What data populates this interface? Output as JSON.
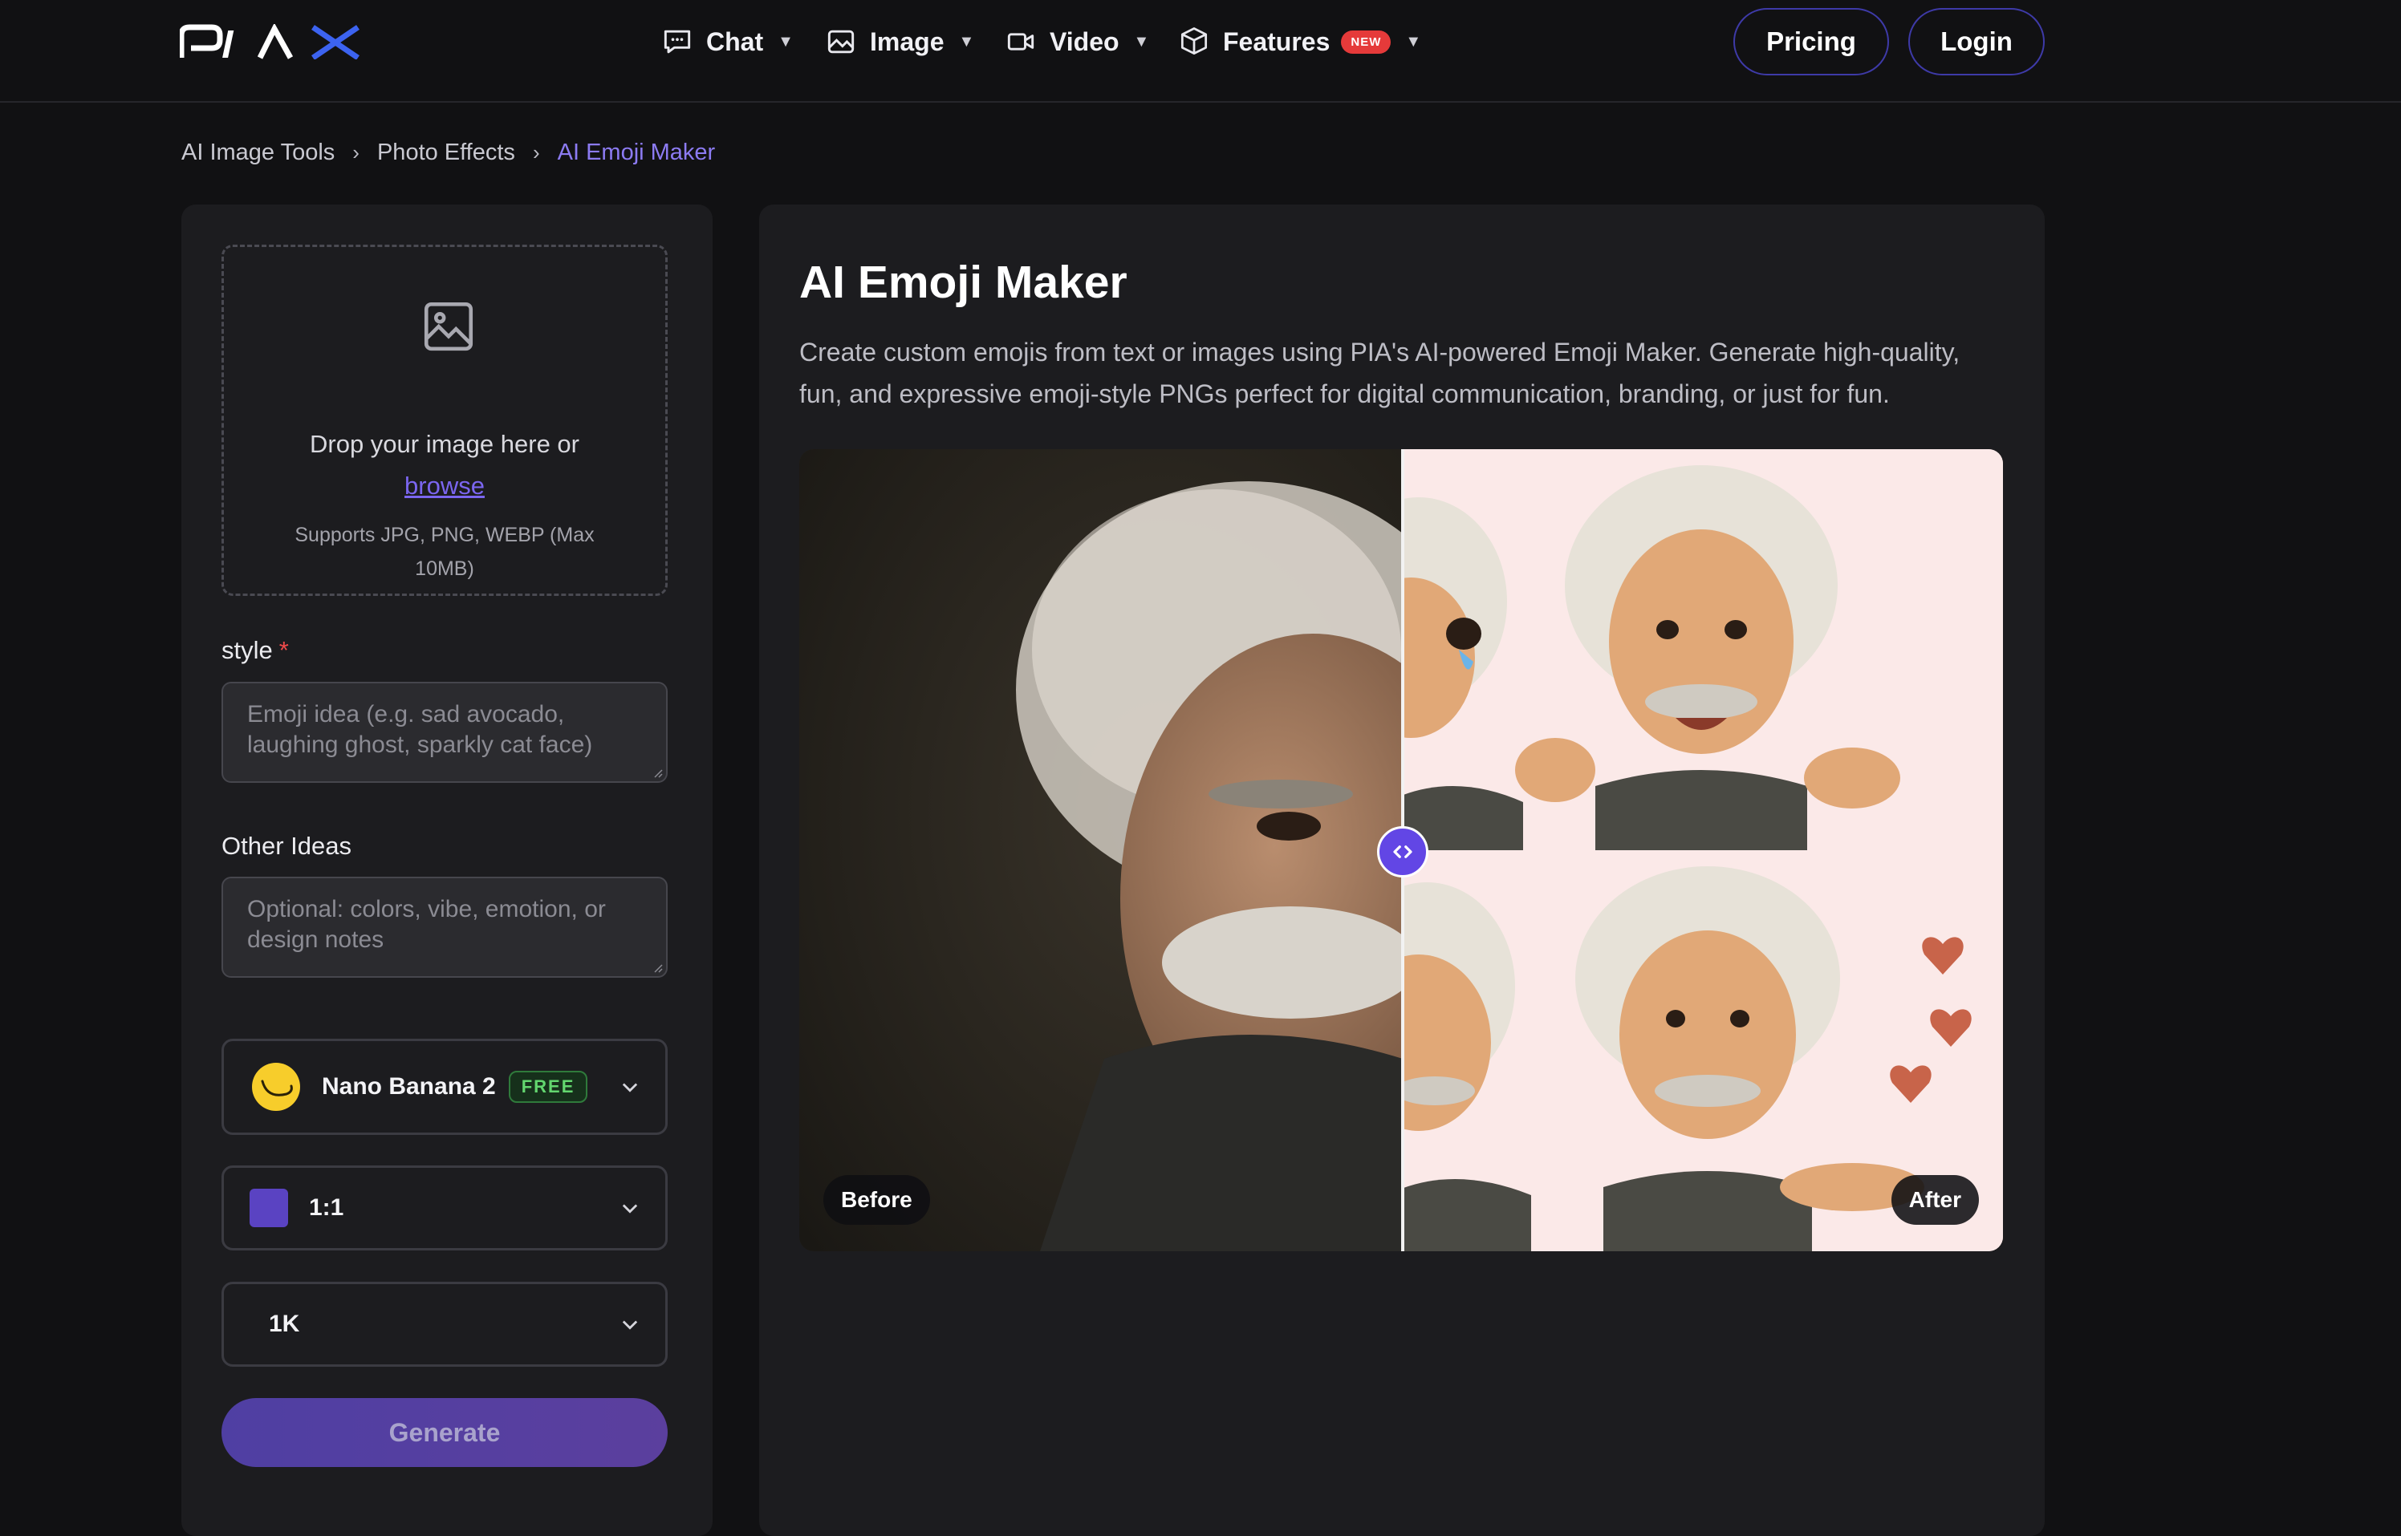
{
  "nav": {
    "logo_text": "PIAX",
    "items": [
      {
        "label": "Chat",
        "icon": "chat-bubble-icon"
      },
      {
        "label": "Image",
        "icon": "image-icon"
      },
      {
        "label": "Video",
        "icon": "video-camera-icon"
      },
      {
        "label": "Features",
        "icon": "box-icon",
        "badge": "NEW"
      }
    ],
    "pricing_label": "Pricing",
    "login_label": "Login"
  },
  "breadcrumb": {
    "items": [
      "AI Image Tools",
      "Photo Effects",
      "AI Emoji Maker"
    ],
    "separator": "›"
  },
  "upload": {
    "line1": "Drop your image here or",
    "browse_label": "browse",
    "supports": "Supports JPG, PNG, WEBP (Max 10MB)"
  },
  "style_field": {
    "label": "style",
    "required_mark": "*",
    "placeholder": "Emoji idea (e.g. sad avocado, laughing ghost, sparkly cat face)"
  },
  "other_field": {
    "label": "Other Ideas",
    "placeholder": "Optional: colors, vibe, emotion, or design notes"
  },
  "model_select": {
    "value": "Nano Banana 2",
    "badge": "FREE"
  },
  "ratio_select": {
    "value": "1:1",
    "swatch_color": "#5a43c2"
  },
  "resolution_select": {
    "value": "1K"
  },
  "generate_label": "Generate",
  "main": {
    "title": "AI Emoji Maker",
    "description": "Create custom emojis from text or images using PIA's AI-powered Emoji Maker. Generate high-quality, fun, and expressive emoji-style PNGs perfect for digital communication, branding, or just for fun."
  },
  "comparison": {
    "before_label": "Before",
    "after_label": "After"
  },
  "colors": {
    "accent": "#6246e5",
    "background": "#111113",
    "panel": "#1c1c1f",
    "link": "#7b66f0"
  }
}
